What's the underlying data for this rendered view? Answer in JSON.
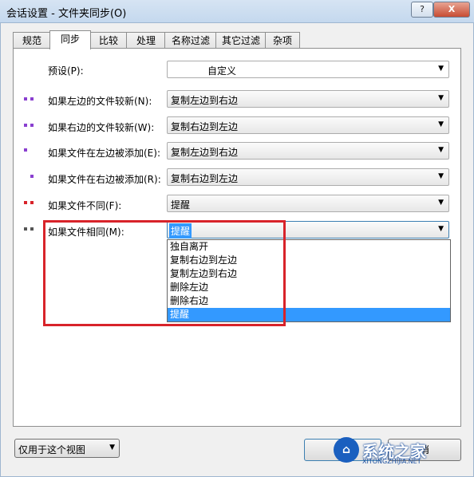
{
  "window": {
    "title": "会话设置 - 文件夹同步(O)",
    "help_label": "?",
    "close_label": "X"
  },
  "tabs": [
    {
      "label": "规范"
    },
    {
      "label": "同步"
    },
    {
      "label": "比较"
    },
    {
      "label": "处理"
    },
    {
      "label": "名称过滤"
    },
    {
      "label": "其它过滤"
    },
    {
      "label": "杂项"
    }
  ],
  "sync": {
    "rows": [
      {
        "label": "预设(P):",
        "value": "自定义"
      },
      {
        "label": "如果左边的文件较新(N):",
        "value": "复制左边到右边"
      },
      {
        "label": "如果右边的文件较新(W):",
        "value": "复制右边到左边"
      },
      {
        "label": "如果文件在左边被添加(E):",
        "value": "复制左边到右边"
      },
      {
        "label": "如果文件在右边被添加(R):",
        "value": "复制右边到左边"
      },
      {
        "label": "如果文件不同(F):",
        "value": "提醒"
      },
      {
        "label": "如果文件相同(M):",
        "value": "提醒"
      }
    ],
    "dropdown_options": [
      "独自离开",
      "复制右边到左边",
      "复制左边到右边",
      "删除左边",
      "删除右边",
      "提醒"
    ],
    "dropdown_selected": "提醒"
  },
  "footer": {
    "view_option": "仅用于这个视图",
    "ok_label": "确",
    "cancel_label": "消"
  },
  "watermark": {
    "text": "系统之家",
    "sub": "XITONGZHIJIA.NET"
  },
  "colors": {
    "highlight": "#3399ff",
    "annotation_box": "#d8232a",
    "marker_purple": "#8a3fd0",
    "marker_red": "#d8232a",
    "marker_gray": "#555555"
  }
}
